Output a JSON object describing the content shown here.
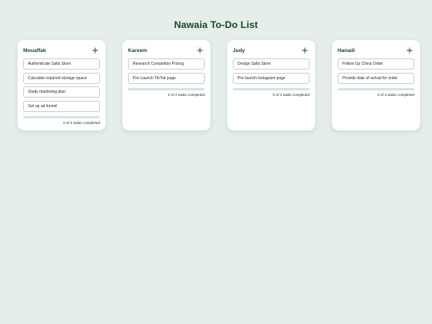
{
  "page": {
    "title": "Nawaia To-Do List"
  },
  "colors": {
    "background": "#e5eee9",
    "title": "#14482f",
    "track": "#d6e6dd",
    "accent": "#2e7d55"
  },
  "lists": [
    {
      "name": "Mouaffak",
      "add_icon": "plus-icon",
      "tasks": [
        "Authenticate Salla Store",
        "Calculate required storage space",
        "Study marketing plan",
        "Set up ad funnel"
      ],
      "completed": 0,
      "total": 4,
      "progress_label": "tasks completed"
    },
    {
      "name": "Kareem",
      "add_icon": "plus-icon",
      "tasks": [
        "Research Competitor Pricing",
        "Pre-Launch TikTok page"
      ],
      "completed": 0,
      "total": 2,
      "progress_label": "tasks completed"
    },
    {
      "name": "Judy",
      "add_icon": "plus-icon",
      "tasks": [
        "Design Salla Store",
        "Pre launch instagram page"
      ],
      "completed": 0,
      "total": 2,
      "progress_label": "tasks completed"
    },
    {
      "name": "Hanadi",
      "add_icon": "plus-icon",
      "tasks": [
        "Follow Up China Order",
        "Provide date of arrival for order"
      ],
      "completed": 0,
      "total": 2,
      "progress_label": "tasks completed"
    }
  ]
}
